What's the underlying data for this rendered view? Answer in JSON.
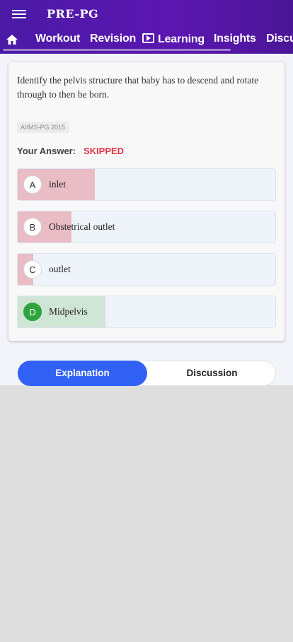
{
  "app": {
    "title": "PRE-PG"
  },
  "tabs": [
    {
      "label": "Workout"
    },
    {
      "label": "Revision"
    },
    {
      "label": "Learning"
    },
    {
      "label": "Insights"
    },
    {
      "label": "Discussion"
    }
  ],
  "question": {
    "text": "Identify the pelvis structure that baby has to descend and rotate through to then be born.",
    "tag": "AIIMS-PG 2015",
    "your_answer_label": "Your Answer:",
    "your_answer_value": "SKIPPED"
  },
  "options": [
    {
      "letter": "A",
      "text": "inlet",
      "fill_fraction": 0.3,
      "status": "incorrect"
    },
    {
      "letter": "B",
      "text": "Obstetrical outlet",
      "fill_fraction": 0.21,
      "status": "incorrect"
    },
    {
      "letter": "C",
      "text": "outlet",
      "fill_fraction": 0.06,
      "status": "incorrect"
    },
    {
      "letter": "D",
      "text": "Midpelvis",
      "fill_fraction": 0.34,
      "status": "correct"
    }
  ],
  "segments": {
    "explanation": "Explanation",
    "discussion": "Discussion"
  },
  "colors": {
    "appbar": "#5216a6",
    "accent": "#3161f5",
    "skipped": "#e03545",
    "correct": "#2fa43e",
    "incorrect_fill": "#eabcc6",
    "correct_fill": "#cfe5d5"
  },
  "icons": {
    "menu": "menu-icon",
    "home": "home-icon",
    "learning": "play-box-icon"
  }
}
